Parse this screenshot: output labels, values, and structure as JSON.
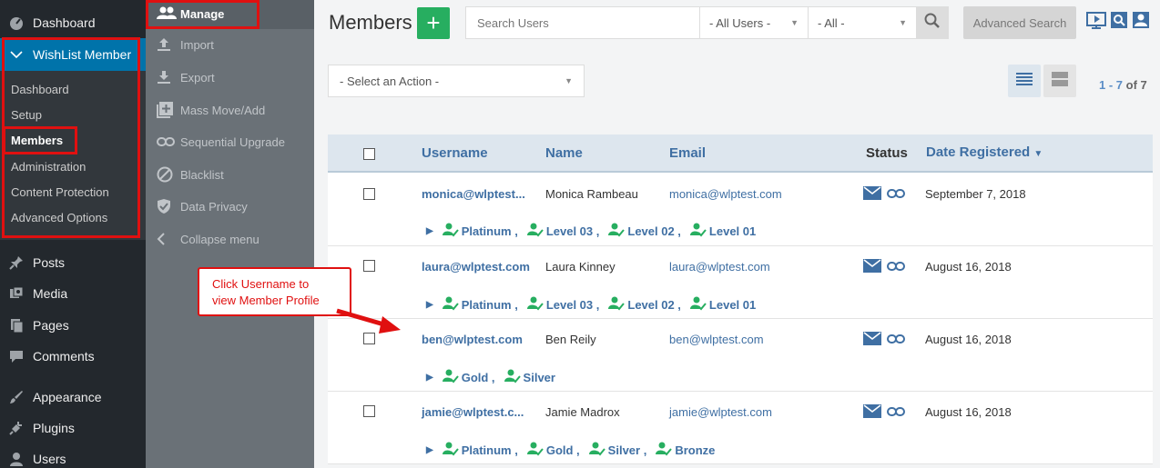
{
  "wp_sidebar": {
    "dashboard": "Dashboard",
    "wishlist": "WishList Member",
    "sub": [
      "Dashboard",
      "Setup",
      "Members",
      "Administration",
      "Content Protection",
      "Advanced Options"
    ],
    "posts": "Posts",
    "media": "Media",
    "pages": "Pages",
    "comments": "Comments",
    "appearance": "Appearance",
    "plugins": "Plugins",
    "users": "Users"
  },
  "wlm_nav": {
    "manage": "Manage",
    "import": "Import",
    "export": "Export",
    "mass_move": "Mass Move/Add",
    "sequential": "Sequential Upgrade",
    "blacklist": "Blacklist",
    "privacy": "Data Privacy",
    "collapse": "Collapse menu"
  },
  "header": {
    "title": "Members",
    "add_label": "+",
    "search_placeholder": "Search Users",
    "filter_users": "- All Users -",
    "filter_all": "- All -",
    "advanced_search": "Advanced Search"
  },
  "toolbar": {
    "action_select": "- Select an Action -",
    "pager_start": "1",
    "pager_sep": " - ",
    "pager_end": "7",
    "pager_of": " of 7"
  },
  "table": {
    "headers": {
      "username": "Username",
      "name": "Name",
      "email": "Email",
      "status": "Status",
      "date": "Date Registered"
    },
    "rows": [
      {
        "username": "monica@wlptest...",
        "name": "Monica Rambeau",
        "email": "monica@wlptest.com",
        "date": "September 7, 2018",
        "levels": [
          "Platinum ,",
          "Level 03 ,",
          "Level 02 ,",
          "Level 01"
        ]
      },
      {
        "username": "laura@wlptest.com",
        "name": "Laura Kinney",
        "email": "laura@wlptest.com",
        "date": "August 16, 2018",
        "levels": [
          "Platinum ,",
          "Level 03 ,",
          "Level 02 ,",
          "Level 01"
        ]
      },
      {
        "username": "ben@wlptest.com",
        "name": "Ben Reily",
        "email": "ben@wlptest.com",
        "date": "August 16, 2018",
        "levels": [
          "Gold ,",
          "Silver"
        ]
      },
      {
        "username": "jamie@wlptest.c...",
        "name": "Jamie Madrox",
        "email": "jamie@wlptest.com",
        "date": "August 16, 2018",
        "levels": [
          "Platinum ,",
          "Gold ,",
          "Silver ,",
          "Bronze"
        ]
      }
    ]
  },
  "callout": {
    "line1": "Click Username to",
    "line2": "view Member Profile"
  },
  "colors": {
    "accent": "#3f6fa3",
    "green": "#27ae60",
    "highlight": "#e01010",
    "wp_blue": "#0073aa"
  }
}
